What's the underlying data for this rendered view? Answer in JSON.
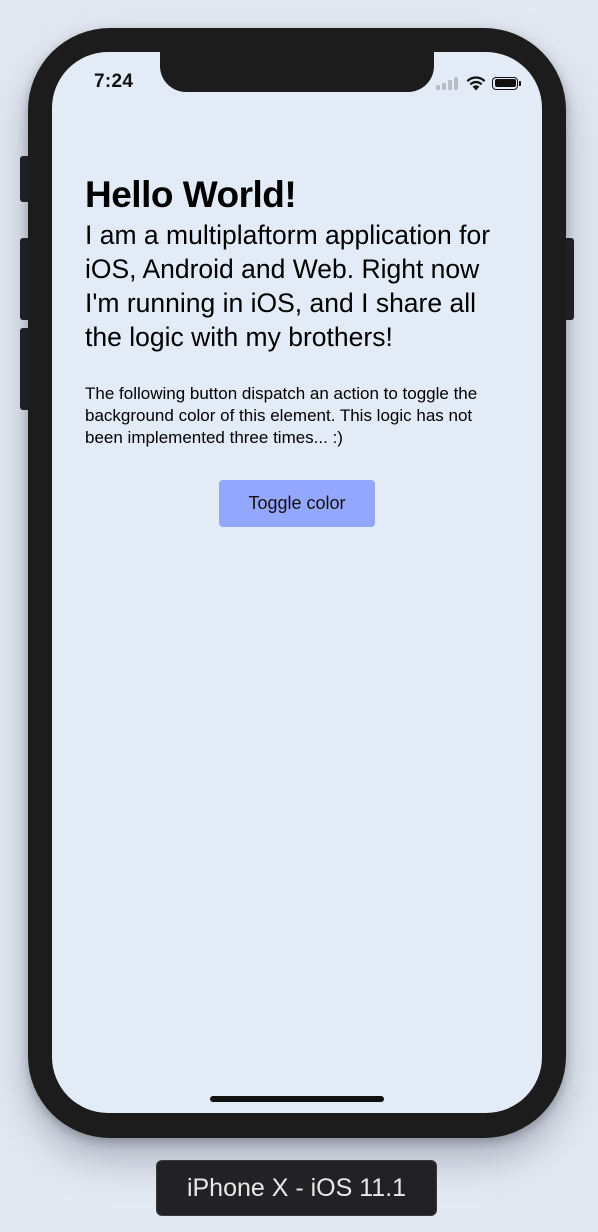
{
  "status_bar": {
    "time": "7:24",
    "icons": [
      "cellular-signal-icon",
      "wifi-icon",
      "battery-icon"
    ]
  },
  "main": {
    "title": "Hello World!",
    "intro": "I am a multiplaftorm application for iOS, Android and Web. Right now I'm running in iOS, and I share all the logic with my brothers!",
    "note": "The following button dispatch an action to toggle the background color of this element. This logic has not been implemented three times... :)",
    "toggle_button_label": "Toggle color"
  },
  "device": {
    "label": "iPhone X - iOS 11.1"
  },
  "colors": {
    "screen_background": "#e2ebf6",
    "button_background": "#93a7ff",
    "frame": "#1c1c1d"
  }
}
